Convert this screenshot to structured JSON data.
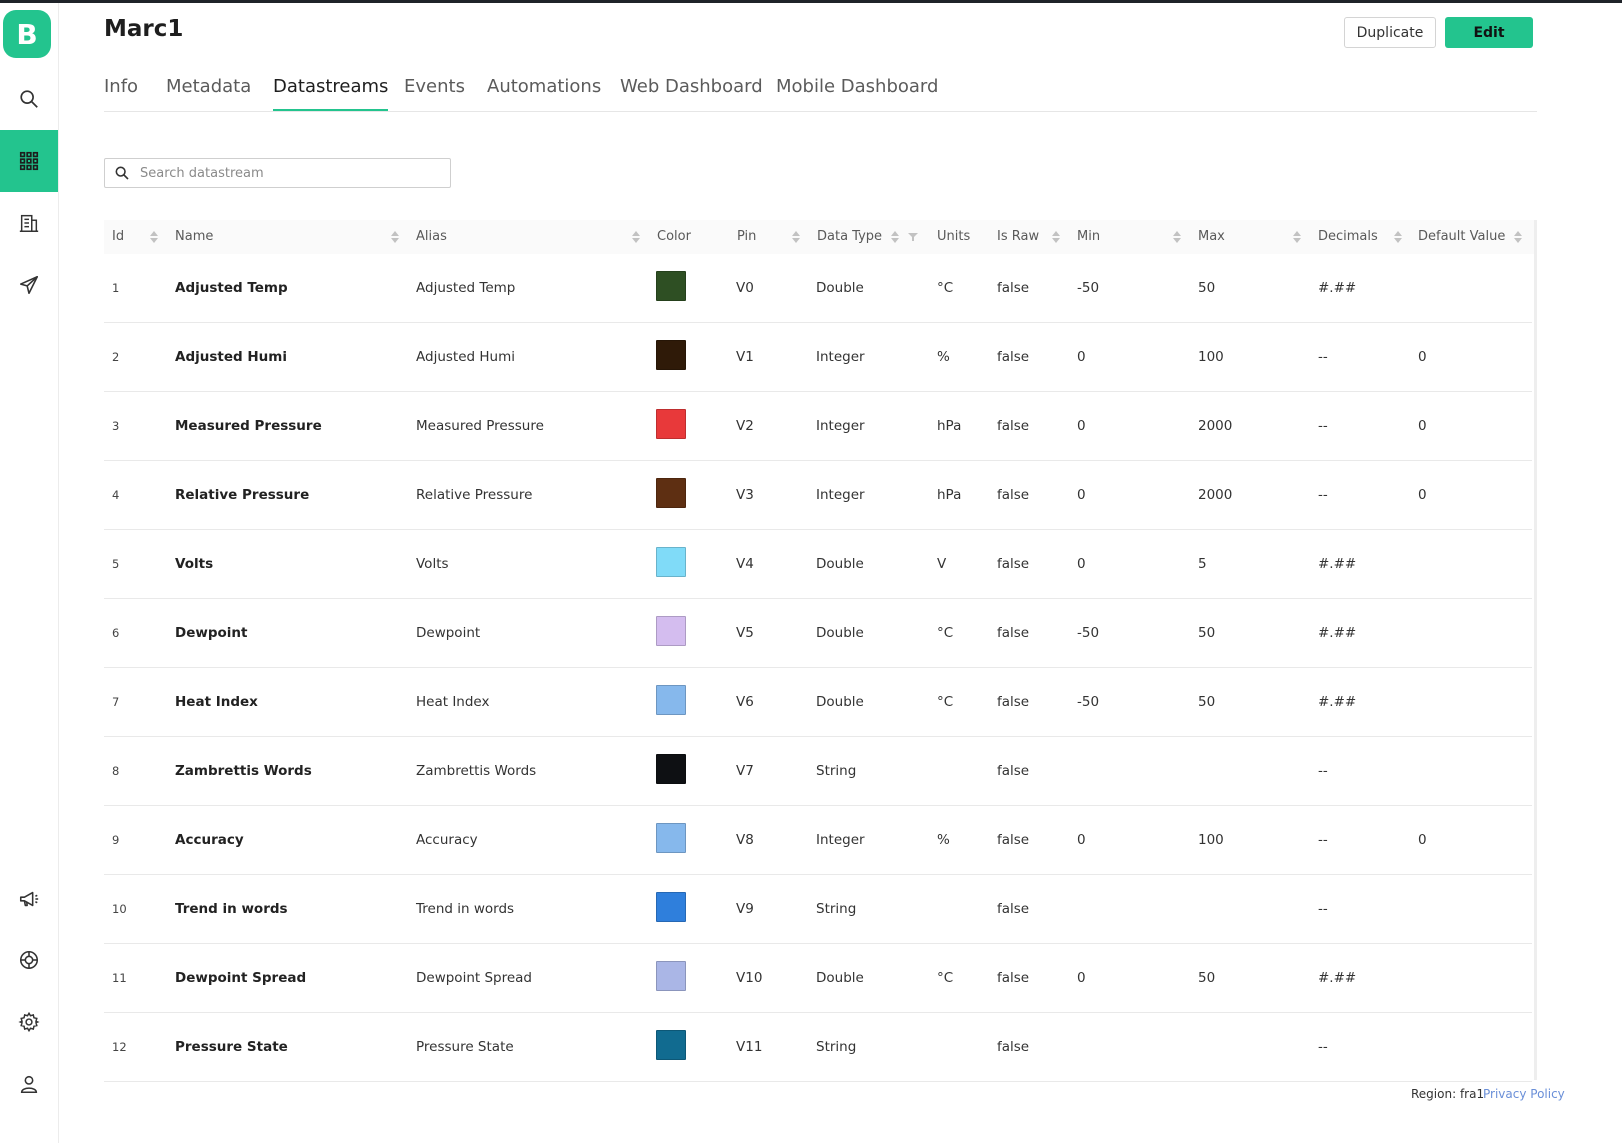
{
  "app": {
    "logo_letter": "B",
    "accent_color": "#23c48e"
  },
  "sidebar": {
    "items": [
      {
        "name": "search",
        "icon": "search-icon",
        "active": false
      },
      {
        "name": "devices",
        "icon": "grid-icon",
        "active": true
      },
      {
        "name": "organizations",
        "icon": "building-icon",
        "active": false
      },
      {
        "name": "messages",
        "icon": "send-icon",
        "active": false
      },
      {
        "name": "announcements",
        "icon": "megaphone-icon",
        "active": false
      },
      {
        "name": "help",
        "icon": "lifebuoy-icon",
        "active": false
      },
      {
        "name": "settings",
        "icon": "gear-icon",
        "active": false
      },
      {
        "name": "profile",
        "icon": "user-icon",
        "active": false
      }
    ]
  },
  "header": {
    "title": "Marc1",
    "duplicate_label": "Duplicate",
    "edit_label": "Edit"
  },
  "tabs": [
    {
      "label": "Info",
      "active": false
    },
    {
      "label": "Metadata",
      "active": false
    },
    {
      "label": "Datastreams",
      "active": true
    },
    {
      "label": "Events",
      "active": false
    },
    {
      "label": "Automations",
      "active": false
    },
    {
      "label": "Web Dashboard",
      "active": false
    },
    {
      "label": "Mobile Dashboard",
      "active": false
    }
  ],
  "search": {
    "placeholder": "Search datastream",
    "value": ""
  },
  "table": {
    "columns": [
      "Id",
      "Name",
      "Alias",
      "Color",
      "Pin",
      "Data Type",
      "Units",
      "Is Raw",
      "Min",
      "Max",
      "Decimals",
      "Default Value"
    ],
    "rows": [
      {
        "id": "1",
        "name": "Adjusted Temp",
        "alias": "Adjusted Temp",
        "color": "#2e4f23",
        "pin": "V0",
        "type": "Double",
        "units": "°C",
        "raw": "false",
        "min": "-50",
        "max": "50",
        "decimals": "#.##",
        "default": ""
      },
      {
        "id": "2",
        "name": "Adjusted Humi",
        "alias": "Adjusted Humi",
        "color": "#2f1a08",
        "pin": "V1",
        "type": "Integer",
        "units": "%",
        "raw": "false",
        "min": "0",
        "max": "100",
        "decimals": "--",
        "default": "0"
      },
      {
        "id": "3",
        "name": "Measured Pressure",
        "alias": "Measured Pressure",
        "color": "#e8393a",
        "pin": "V2",
        "type": "Integer",
        "units": "hPa",
        "raw": "false",
        "min": "0",
        "max": "2000",
        "decimals": "--",
        "default": "0"
      },
      {
        "id": "4",
        "name": "Relative Pressure",
        "alias": "Relative Pressure",
        "color": "#5e2f12",
        "pin": "V3",
        "type": "Integer",
        "units": "hPa",
        "raw": "false",
        "min": "0",
        "max": "2000",
        "decimals": "--",
        "default": "0"
      },
      {
        "id": "5",
        "name": "Volts",
        "alias": "Volts",
        "color": "#80dbf8",
        "pin": "V4",
        "type": "Double",
        "units": "V",
        "raw": "false",
        "min": "0",
        "max": "5",
        "decimals": "#.##",
        "default": ""
      },
      {
        "id": "6",
        "name": "Dewpoint",
        "alias": "Dewpoint",
        "color": "#d4bdef",
        "pin": "V5",
        "type": "Double",
        "units": "°C",
        "raw": "false",
        "min": "-50",
        "max": "50",
        "decimals": "#.##",
        "default": ""
      },
      {
        "id": "7",
        "name": "Heat Index",
        "alias": "Heat Index",
        "color": "#86b8ec",
        "pin": "V6",
        "type": "Double",
        "units": "°C",
        "raw": "false",
        "min": "-50",
        "max": "50",
        "decimals": "#.##",
        "default": ""
      },
      {
        "id": "8",
        "name": "Zambrettis Words",
        "alias": "Zambrettis Words",
        "color": "#0e1013",
        "pin": "V7",
        "type": "String",
        "units": "",
        "raw": "false",
        "min": "",
        "max": "",
        "decimals": "--",
        "default": ""
      },
      {
        "id": "9",
        "name": "Accuracy",
        "alias": "Accuracy",
        "color": "#86b8ec",
        "pin": "V8",
        "type": "Integer",
        "units": "%",
        "raw": "false",
        "min": "0",
        "max": "100",
        "decimals": "--",
        "default": "0"
      },
      {
        "id": "10",
        "name": "Trend in words",
        "alias": "Trend in words",
        "color": "#2f7fdc",
        "pin": "V9",
        "type": "String",
        "units": "",
        "raw": "false",
        "min": "",
        "max": "",
        "decimals": "--",
        "default": ""
      },
      {
        "id": "11",
        "name": "Dewpoint Spread",
        "alias": "Dewpoint Spread",
        "color": "#aab6e6",
        "pin": "V10",
        "type": "Double",
        "units": "°C",
        "raw": "false",
        "min": "0",
        "max": "50",
        "decimals": "#.##",
        "default": ""
      },
      {
        "id": "12",
        "name": "Pressure State",
        "alias": "Pressure State",
        "color": "#116b90",
        "pin": "V11",
        "type": "String",
        "units": "",
        "raw": "false",
        "min": "",
        "max": "",
        "decimals": "--",
        "default": ""
      }
    ]
  },
  "footer": {
    "region": "Region: fra1",
    "privacy": "Privacy Policy"
  }
}
